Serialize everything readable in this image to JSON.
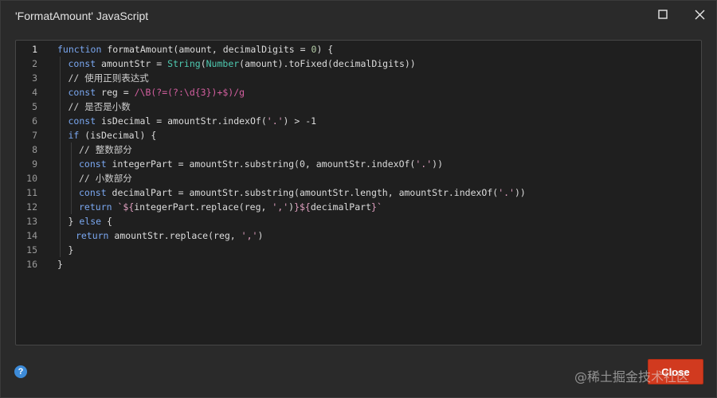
{
  "window": {
    "title": "'FormatAmount' JavaScript"
  },
  "footer": {
    "help_label": "?",
    "close_label": "Close",
    "watermark": "@稀土掘金技术社区"
  },
  "editor": {
    "active_line": 1,
    "lines": [
      {
        "n": "1",
        "indent": 0,
        "tokens": [
          [
            "kw",
            "function "
          ],
          [
            "fn",
            "formatAmount(amount, decimalDigits = "
          ],
          [
            "num",
            "0"
          ],
          [
            "fn",
            ") {"
          ]
        ]
      },
      {
        "n": "2",
        "indent": 1,
        "tokens": [
          [
            "kw",
            "const "
          ],
          [
            "fn",
            "amountStr = "
          ],
          [
            "ty",
            "String"
          ],
          [
            "fn",
            "("
          ],
          [
            "ty",
            "Number"
          ],
          [
            "fn",
            "(amount).toFixed(decimalDigits))"
          ]
        ]
      },
      {
        "n": "3",
        "indent": 1,
        "tokens": [
          [
            "cm",
            "// 使用正则表达式"
          ]
        ]
      },
      {
        "n": "4",
        "indent": 1,
        "tokens": [
          [
            "kw",
            "const "
          ],
          [
            "fn",
            "reg = "
          ],
          [
            "re",
            "/\\B(?=(?:\\d{3})+$)/g"
          ]
        ]
      },
      {
        "n": "5",
        "indent": 1,
        "tokens": [
          [
            "cm",
            "// 是否是小数"
          ]
        ]
      },
      {
        "n": "6",
        "indent": 1,
        "tokens": [
          [
            "kw",
            "const "
          ],
          [
            "fn",
            "isDecimal = amountStr.indexOf("
          ],
          [
            "str",
            "'.'"
          ],
          [
            "fn",
            ") > -1"
          ]
        ]
      },
      {
        "n": "7",
        "indent": 1,
        "tokens": [
          [
            "kw",
            "if "
          ],
          [
            "fn",
            "(isDecimal) {"
          ]
        ]
      },
      {
        "n": "8",
        "indent": 2,
        "tokens": [
          [
            "cm",
            "// 整数部分"
          ]
        ]
      },
      {
        "n": "9",
        "indent": 2,
        "tokens": [
          [
            "kw",
            "const "
          ],
          [
            "fn",
            "integerPart = amountStr.substring(0, amountStr.indexOf("
          ],
          [
            "str",
            "'.'"
          ],
          [
            "fn",
            "))"
          ]
        ]
      },
      {
        "n": "10",
        "indent": 2,
        "tokens": [
          [
            "cm",
            "// 小数部分"
          ]
        ]
      },
      {
        "n": "11",
        "indent": 2,
        "tokens": [
          [
            "kw",
            "const "
          ],
          [
            "fn",
            "decimalPart = amountStr.substring(amountStr.length, amountStr.indexOf("
          ],
          [
            "str",
            "'.'"
          ],
          [
            "fn",
            "))"
          ]
        ]
      },
      {
        "n": "12",
        "indent": 2,
        "tokens": [
          [
            "kw",
            "return "
          ],
          [
            "str",
            "`${"
          ],
          [
            "fn",
            "integerPart.replace(reg, "
          ],
          [
            "str",
            "','"
          ],
          [
            "fn",
            ")"
          ],
          [
            "str",
            "}${"
          ],
          [
            "fn",
            "decimalPart"
          ],
          [
            "str",
            "}`"
          ]
        ]
      },
      {
        "n": "13",
        "indent": 1,
        "tokens": [
          [
            "fn",
            "} "
          ],
          [
            "kw",
            "else "
          ],
          [
            "fn",
            "{"
          ]
        ]
      },
      {
        "n": "14",
        "indent": 1.7,
        "tokens": [
          [
            "kw",
            "return "
          ],
          [
            "fn",
            "amountStr.replace(reg, "
          ],
          [
            "str",
            "','"
          ],
          [
            "fn",
            ")"
          ]
        ]
      },
      {
        "n": "15",
        "indent": 1,
        "tokens": [
          [
            "fn",
            "}"
          ]
        ]
      },
      {
        "n": "16",
        "indent": 0,
        "tokens": [
          [
            "fn",
            "}"
          ]
        ]
      }
    ]
  },
  "colors": {
    "keyword": "#7aa7f0",
    "type": "#4ec9b0",
    "string": "#e0a0c0",
    "regex": "#d45fa0",
    "close_button": "#d13a1f",
    "help_icon": "#3d8bd8"
  }
}
